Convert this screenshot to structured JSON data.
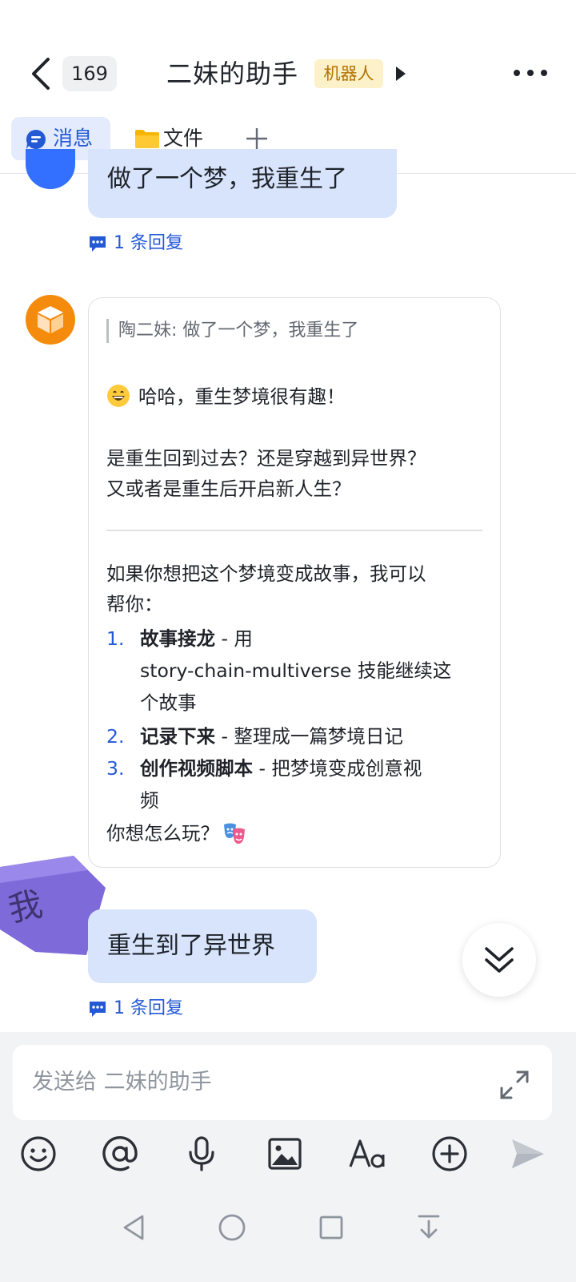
{
  "header": {
    "back_badge": "169",
    "title": "二妹的助手",
    "bot_tag": "机器人"
  },
  "tabs": [
    {
      "label": "消息",
      "active": true
    },
    {
      "label": "文件",
      "active": false
    }
  ],
  "messages": {
    "first_user_message": "做了一个梦，我重生了",
    "first_reply_count": "1 条回复",
    "bot_reply": {
      "quote": "陶二妹: 做了一个梦，我重生了",
      "greeting": "哈哈，重生梦境很有趣！",
      "question_line1": "是重生回到过去？还是穿越到异世界？",
      "question_line2": "又或者是重生后开启新人生？",
      "offer_line1": "如果你想把这个梦境变成故事，我可以",
      "offer_line2": "帮你：",
      "options": [
        {
          "num": "1.",
          "title": "故事接龙",
          "desc": " - 用",
          "cont1": "story-chain-multiverse 技能继续这",
          "cont2": "个故事"
        },
        {
          "num": "2.",
          "title": "记录下来",
          "desc": " - 整理成一篇梦境日记"
        },
        {
          "num": "3.",
          "title": "创作视频脚本",
          "desc": " - 把梦境变成创意视",
          "cont1": "频"
        }
      ],
      "closing": "你想怎么玩？"
    },
    "me_label": "我",
    "second_user_message": "重生到了异世界",
    "second_reply_count": "1 条回复"
  },
  "composer": {
    "placeholder": "发送给 二妹的助手"
  },
  "colors": {
    "accent": "#2459d6",
    "user_bubble": "#d7e4fc",
    "bot_tag_bg": "#fdf1c9",
    "bot_avatar": "#f58b0c"
  }
}
